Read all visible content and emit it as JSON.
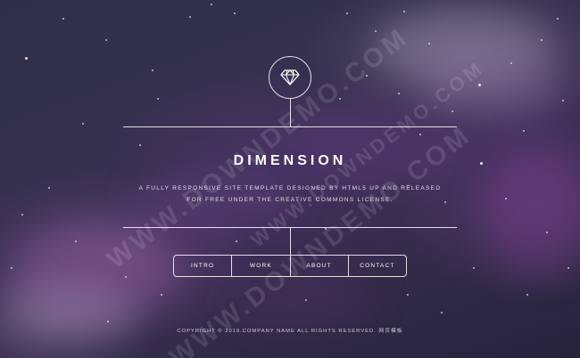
{
  "site": {
    "title": "DIMENSION",
    "tagline_line1": "A FULLY RESPONSIVE SITE TEMPLATE DESIGNED BY HTML5 UP AND RELEASED",
    "tagline_line2": "FOR FREE UNDER THE CREATIVE COMMONS LICENSE.",
    "logo_icon": "diamond-icon"
  },
  "nav": {
    "items": [
      {
        "label": "INTRO"
      },
      {
        "label": "WORK"
      },
      {
        "label": "ABOUT"
      },
      {
        "label": "CONTACT"
      }
    ]
  },
  "footer": {
    "copyright": "COPYRIGHT © 2019.COMPANY NAME ALL RIGHTS RESERVED.",
    "link": "网页模板"
  },
  "watermarks": [
    "WWW.DOWNDEMO.COM",
    "WWW.DOWNDEMO.COM",
    "WWW.DOWNDEMO.COM"
  ],
  "colors": {
    "background": "#2d2a45",
    "accent_purple": "#5a3d78",
    "foreground": "#ffffff"
  }
}
